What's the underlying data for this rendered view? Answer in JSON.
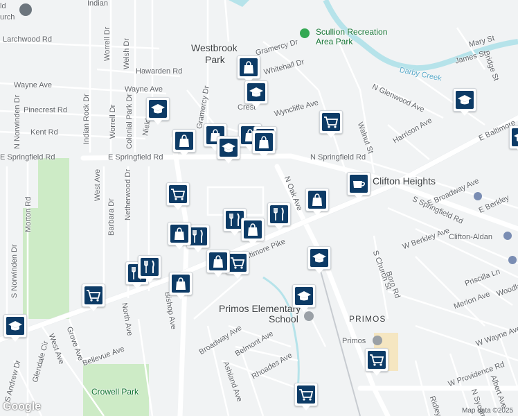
{
  "map": {
    "roads": [
      {
        "name": "Larchwood Rd"
      },
      {
        "name": "Hawarden Rd"
      },
      {
        "name": "Wayne Ave"
      },
      {
        "name": "Wayne Ave"
      },
      {
        "name": "Pinecrest Rd"
      },
      {
        "name": "Kent Rd"
      },
      {
        "name": "E Springfield Rd"
      },
      {
        "name": "N Springfield Rd"
      },
      {
        "name": "Indian Rock Dr"
      },
      {
        "name": "Worrell Dr"
      },
      {
        "name": "Welsh Dr"
      },
      {
        "name": "Colonial Park Dr"
      },
      {
        "name": "Gramercy Dr"
      },
      {
        "name": "Gramercy Dr"
      },
      {
        "name": "Whitehall Dr"
      },
      {
        "name": "Wyncliffe Ave"
      },
      {
        "name": "N Oak Ave"
      },
      {
        "name": "Baltimore Pike"
      },
      {
        "name": "E Baltimore"
      },
      {
        "name": "S Springfield Rd"
      },
      {
        "name": "E Broadway Ave"
      },
      {
        "name": "E Berkley"
      },
      {
        "name": "W Berkley Ave"
      },
      {
        "name": "S Church St"
      },
      {
        "name": "Boro Rd"
      },
      {
        "name": "Priscilla Ln"
      },
      {
        "name": "Merion Ave"
      },
      {
        "name": "W Wayne Ave"
      },
      {
        "name": "Woodlawn"
      },
      {
        "name": "W Providence Rd"
      },
      {
        "name": "Albert Ave"
      },
      {
        "name": "Ridley"
      },
      {
        "name": "Belmont Ave"
      },
      {
        "name": "Rhoades Ave"
      },
      {
        "name": "Ashland Ave"
      },
      {
        "name": "Broadway Ave"
      },
      {
        "name": "Bishop Ave"
      },
      {
        "name": "North Ave"
      },
      {
        "name": "West Ave"
      },
      {
        "name": "Grove Ave"
      },
      {
        "name": "Bellevue Ave"
      },
      {
        "name": "Glendale Cir"
      },
      {
        "name": "S Andrew Dr"
      },
      {
        "name": "S Norwinden Dr"
      },
      {
        "name": "N Norwinden Dr"
      },
      {
        "name": "Morton Rd"
      },
      {
        "name": "West Ave"
      },
      {
        "name": "Barbara Dr"
      },
      {
        "name": "Netherwood Dr"
      },
      {
        "name": "Walnut St"
      },
      {
        "name": "Harrison Ave"
      },
      {
        "name": "N Glenwood Ave"
      },
      {
        "name": "Mary St"
      },
      {
        "name": "Bridge St"
      },
      {
        "name": "James St"
      },
      {
        "name": "N Sycamore"
      },
      {
        "name": "Darby Creek"
      },
      {
        "name": "Indian"
      },
      {
        "name": "Nield"
      },
      {
        "name": "Crest"
      },
      {
        "name": "Gramercy Dr"
      }
    ],
    "places": {
      "westbrook_park": "Westbrook Park",
      "westbrook_park_line2": "Park",
      "westbrook_line1": "Westbrook",
      "clifton_heights": "Clifton Heights",
      "clifton_aldan": "Clifton-Aldan",
      "primos": "PRIMOS",
      "primos_station": "Primos",
      "primos_school_1": "Primos Elementary",
      "primos_school_2": "School",
      "crowell_park": "Crowell Park",
      "scullion_1": "Scullion Recreation",
      "scullion_2": "Area Park",
      "church_partial_1": "ld",
      "church_partial_2": "urch"
    },
    "footer": {
      "attribution": "Map data ©2025",
      "logo": "Google"
    },
    "pins": [
      {
        "kind": "school"
      },
      {
        "kind": "shopping"
      },
      {
        "kind": "school"
      },
      {
        "kind": "shopping"
      },
      {
        "kind": "shopping"
      },
      {
        "kind": "shopping"
      },
      {
        "kind": "school"
      },
      {
        "kind": "shopping"
      },
      {
        "kind": "grocery"
      },
      {
        "kind": "cafe"
      },
      {
        "kind": "shopping"
      },
      {
        "kind": "grocery"
      },
      {
        "kind": "restaurant"
      },
      {
        "kind": "restaurant"
      },
      {
        "kind": "shopping"
      },
      {
        "kind": "restaurant"
      },
      {
        "kind": "shopping"
      },
      {
        "kind": "restaurant"
      },
      {
        "kind": "restaurant"
      },
      {
        "kind": "shopping"
      },
      {
        "kind": "grocery"
      },
      {
        "kind": "school"
      },
      {
        "kind": "grocery"
      },
      {
        "kind": "shopping"
      },
      {
        "kind": "school"
      },
      {
        "kind": "school"
      },
      {
        "kind": "grocery"
      },
      {
        "kind": "grocery"
      },
      {
        "kind": "school"
      },
      {
        "kind": "school"
      },
      {
        "kind": "shopping"
      }
    ]
  }
}
